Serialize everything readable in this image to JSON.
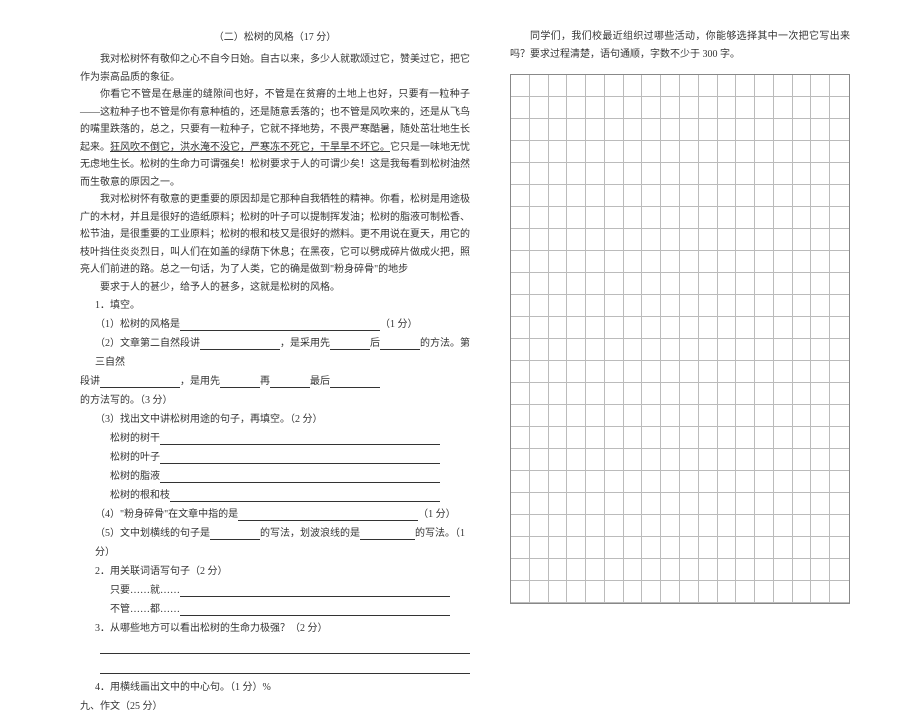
{
  "title": "（二）松树的风格（17 分）",
  "p1": "我对松树怀有敬仰之心不自今日始。自古以来，多少人就歌颂过它，赞美过它，把它作为崇高品质的象征。",
  "p2a": "你看它不管是在悬崖的缝隙间也好，不管是在贫瘠的土地上也好，只要有一粒种子——这粒种子也不管是你有意种植的，还是随意丢落的；也不管是风吹来的，还是从飞鸟的嘴里跌落的，总之，只要有一粒种子，它就不择地势，不畏严寒酷暑，随处茁壮地生长起来。",
  "p2u": "狂风吹不倒它，洪水淹不没它，严寒冻不死它，干旱旱不坏它。",
  "p2b": "它只是一味地无忧无虑地生长。松树的生命力可谓强矣！松树要求于人的可谓少矣！这是我每看到松树油然而生敬意的原因之一。",
  "p3": "我对松树怀有敬意的更重要的原因却是它那种自我牺牲的精神。你看，松树是用途极广的木材，并且是很好的造纸原料；松树的叶子可以提制挥发油；松树的脂液可制松香、松节油，是很重要的工业原料；松树的根和枝又是很好的燃料。更不用说在夏天，用它的枝叶挡住炎炎烈日，叫人们在如盖的绿荫下休息；在黑夜，它可以劈成碎片做成火把，照亮人们前进的路。总之一句话，为了人类，它的确是做到\"粉身碎骨\"的地步",
  "p4": "要求于人的甚少，给予人的甚多，这就是松树的风格。",
  "q1_head": "1．填空。",
  "q1_1a": "（1）松树的风格是",
  "q1_1b": "（1 分）",
  "q1_2a": "（2）文章第二自然段讲",
  "q1_2b": "，是采用先",
  "q1_2c": "后",
  "q1_2d": "的方法。第三自然",
  "q1_2e": "段讲",
  "q1_2f": "，是用先",
  "q1_2g": "再",
  "q1_2h": "最后",
  "q1_2i": "的方法写的。（3 分）",
  "q1_3": "（3）找出文中讲松树用途的句子，再填空。（2 分）",
  "q1_3a": "松树的树干",
  "q1_3b": "松树的叶子",
  "q1_3c": "松树的脂液",
  "q1_3d": "松树的根和枝",
  "q1_4": "（4）\"粉身碎骨\"在文章中指的是",
  "q1_4b": "（1 分）",
  "q1_5a": "（5）文中划横线的句子是",
  "q1_5b": "的写法，划波浪线的是",
  "q1_5c": "的写法。（1 分）",
  "q2": "2．用关联词语写句子（2 分）",
  "q2a": "只要……就……",
  "q2b": "不管……都……",
  "q3": "3．从哪些地方可以看出松树的生命力极强？（2 分）",
  "q4": "4．用横线画出文中的中心句。（1 分）%",
  "sec9": "九、作文（25 分）",
  "right_text": "同学们，我们校最近组织过哪些活动，你能够选择其中一次把它写出来吗？要求过程清楚，语句通顺，字数不少于 300 字。"
}
